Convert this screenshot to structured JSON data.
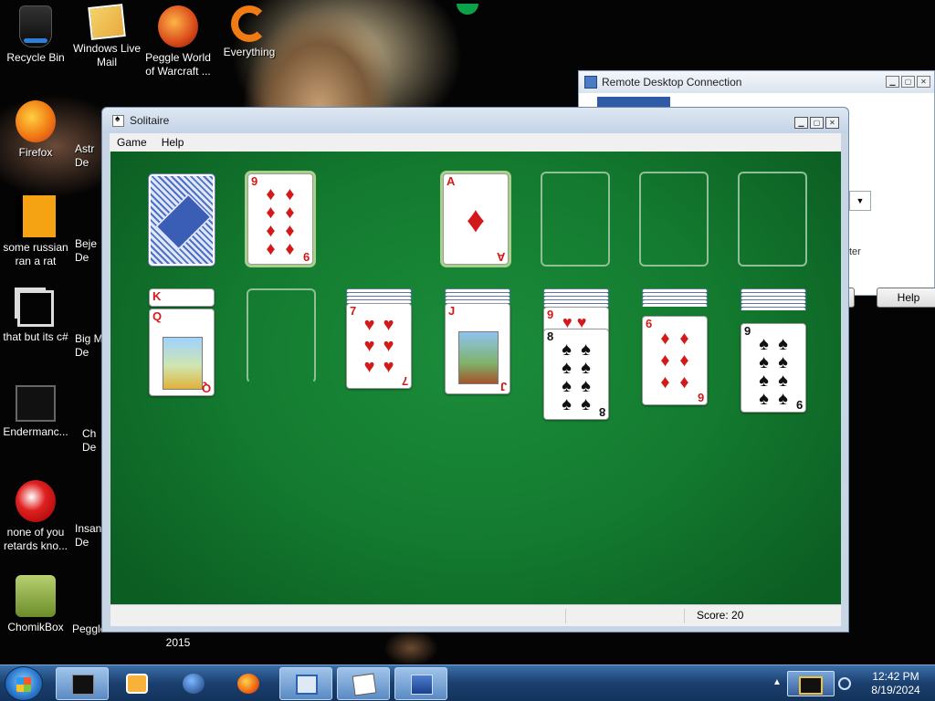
{
  "desktop": {
    "icons": [
      {
        "label": "Recycle Bin",
        "icon": "recycle-bin-icon"
      },
      {
        "label": "Windows Live Mail",
        "icon": "mail-icon"
      },
      {
        "label": "Peggle World of Warcraft ...",
        "icon": "peggle-icon"
      },
      {
        "label": "Everything",
        "icon": "everything-icon"
      },
      {
        "label": "Firefox",
        "icon": "firefox-icon"
      },
      {
        "label": "some russian ran a rat",
        "icon": "document-icon"
      },
      {
        "label": "that but its c#",
        "icon": "shortcut-icon"
      },
      {
        "label": "Endermanc...",
        "icon": "app-icon"
      },
      {
        "label": "none of you retards kno...",
        "icon": "app-icon"
      },
      {
        "label": "ChomikBox",
        "icon": "chomikbox-icon"
      },
      {
        "label": "Astr De",
        "icon": "app-icon"
      },
      {
        "label": "Beje De",
        "icon": "app-icon"
      },
      {
        "label": "Big M De",
        "icon": "app-icon"
      },
      {
        "label": "Ch De",
        "icon": "app-icon"
      },
      {
        "label": "Insan De",
        "icon": "app-icon"
      },
      {
        "label": "Peggle Deluxe",
        "icon": "peggle-icon"
      },
      {
        "label": "Visual Studio 2015",
        "icon": "visual-studio-icon"
      }
    ]
  },
  "remote_desktop": {
    "title": "Remote Desktop Connection",
    "fragment": "ter",
    "button_connect_fragment": "t",
    "button_help": "Help",
    "controls": [
      "minimize",
      "maximize",
      "close"
    ]
  },
  "solitaire": {
    "title": "Solitaire",
    "menu": [
      "Game",
      "Help"
    ],
    "score_label": "Score: 20",
    "stock": {
      "face": "back"
    },
    "waste": {
      "rank": "9",
      "suit": "♦",
      "color": "red"
    },
    "foundations": [
      {
        "rank": "A",
        "suit": "♦",
        "color": "red"
      },
      {
        "empty": true
      },
      {
        "empty": true
      },
      {
        "empty": true
      }
    ],
    "tableau": [
      {
        "hidden": 0,
        "cards": [
          {
            "rank": "K",
            "suit": "",
            "color": "red"
          },
          {
            "rank": "Q",
            "suit": "♦",
            "color": "red"
          }
        ]
      },
      {
        "hidden": 0,
        "cards": []
      },
      {
        "hidden": 4,
        "cards": [
          {
            "rank": "7",
            "suit": "♥",
            "color": "red"
          }
        ]
      },
      {
        "hidden": 4,
        "cards": [
          {
            "rank": "J",
            "suit": "♦",
            "color": "red"
          }
        ]
      },
      {
        "hidden": 5,
        "cards": [
          {
            "rank": "9",
            "suit": "♥",
            "color": "red"
          },
          {
            "rank": "8",
            "suit": "♠",
            "color": "black"
          }
        ]
      },
      {
        "hidden": 5,
        "cards": [
          {
            "rank": "6",
            "suit": "♦",
            "color": "red"
          }
        ]
      },
      {
        "hidden": 6,
        "cards": [
          {
            "rank": "9",
            "suit": "♠",
            "color": "black"
          }
        ]
      }
    ]
  },
  "taskbar": {
    "apps": [
      "terminal-icon",
      "media-player-icon",
      "globe-icon",
      "firefox-icon",
      "keyboard-icon",
      "solitaire-icon",
      "remote-desktop-icon"
    ],
    "clock_time": "12:42 PM",
    "clock_date": "8/19/2024"
  },
  "colors": {
    "felt": "#137a2f",
    "red_suit": "#d31a1a",
    "taskbar": "#1b3f6e"
  }
}
